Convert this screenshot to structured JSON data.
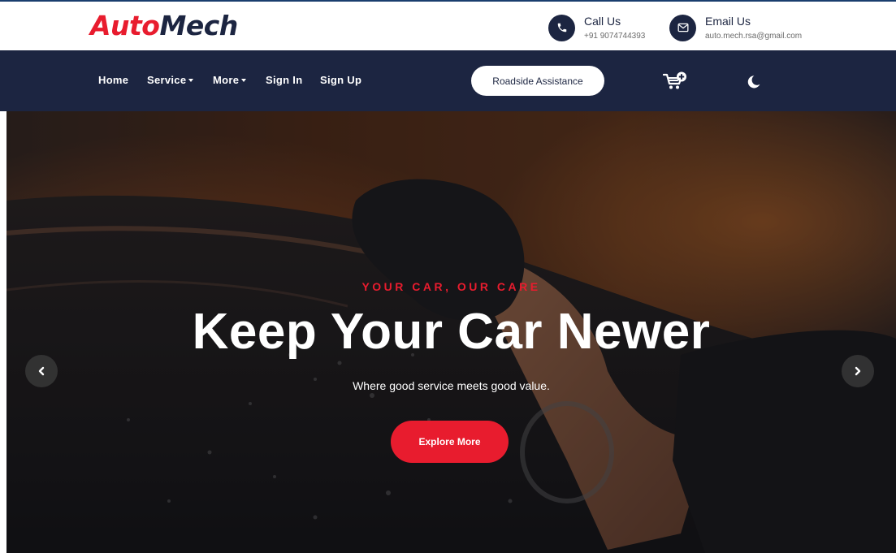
{
  "brand": {
    "part1": "Auto",
    "part2": "Mech",
    "color_primary": "#e81c2e",
    "color_dark": "#1c2541"
  },
  "contacts": {
    "call": {
      "title": "Call Us",
      "value": "+91 9074744393",
      "icon": "phone-icon"
    },
    "email": {
      "title": "Email Us",
      "value": "auto.mech.rsa@gmail.com",
      "icon": "mail-icon"
    }
  },
  "nav": {
    "home": "Home",
    "service": "Service",
    "more": "More",
    "signin": "Sign In",
    "signup": "Sign Up",
    "roadside": "Roadside Assistance",
    "cart_icon": "cart-add-icon",
    "theme_icon": "moon-icon"
  },
  "hero": {
    "eyebrow": "YOUR CAR, OUR CARE",
    "headline": "Keep Your Car Newer",
    "subline": "Where good service meets good value.",
    "button": "Explore More",
    "prev_icon": "chevron-left-icon",
    "next_icon": "chevron-right-icon"
  }
}
